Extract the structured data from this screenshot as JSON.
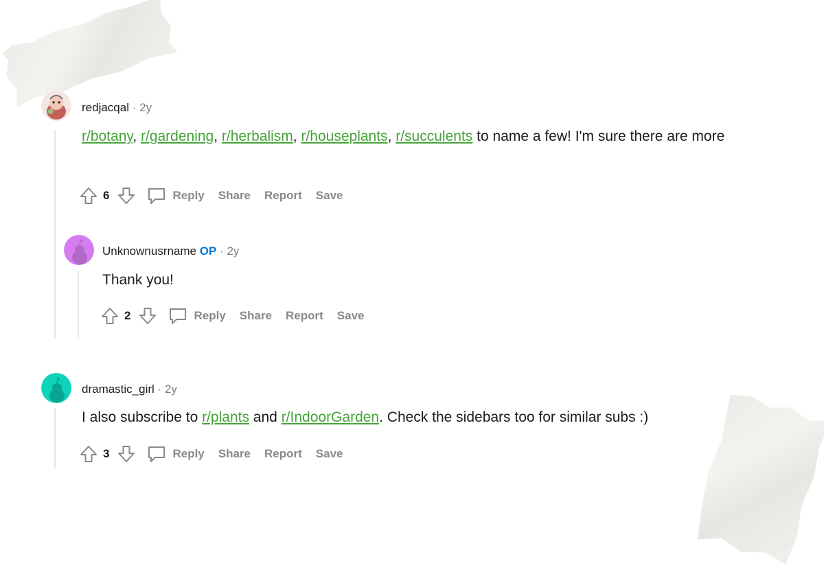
{
  "comments": [
    {
      "username": "redjacqal",
      "age": "2y",
      "body": {
        "links": [
          "r/botany",
          "r/gardening",
          "r/herbalism",
          "r/houseplants",
          "r/succulents"
        ],
        "separator": ", ",
        "text_after": " to name a few! I'm sure there are more"
      },
      "votes": "6",
      "actions": {
        "reply": "Reply",
        "share": "Share",
        "report": "Report",
        "save": "Save"
      }
    },
    {
      "username": "Unknownusrname",
      "op_badge": "OP",
      "age": "2y",
      "body": {
        "text": "Thank you!"
      },
      "votes": "2",
      "actions": {
        "reply": "Reply",
        "share": "Share",
        "report": "Report",
        "save": "Save"
      }
    },
    {
      "username": "dramastic_girl",
      "age": "2y",
      "body": {
        "text_before": "I also subscribe to ",
        "link1": "r/plants",
        "text_mid": " and ",
        "link2": "r/IndoorGarden",
        "text_after": ". Check the sidebars too for similar subs :)"
      },
      "votes": "3",
      "actions": {
        "reply": "Reply",
        "share": "Share",
        "report": "Report",
        "save": "Save"
      }
    }
  ],
  "colors": {
    "link": "#46a339",
    "op_badge": "#0079d3",
    "avatar_purple": "#d67bf0",
    "avatar_teal": "#0dd3bb",
    "action_gray": "#878a8c",
    "thread_line": "#e5e5e5"
  },
  "icons": [
    "upvote-icon",
    "downvote-icon",
    "comment-icon",
    "snoo-avatar-icon"
  ]
}
